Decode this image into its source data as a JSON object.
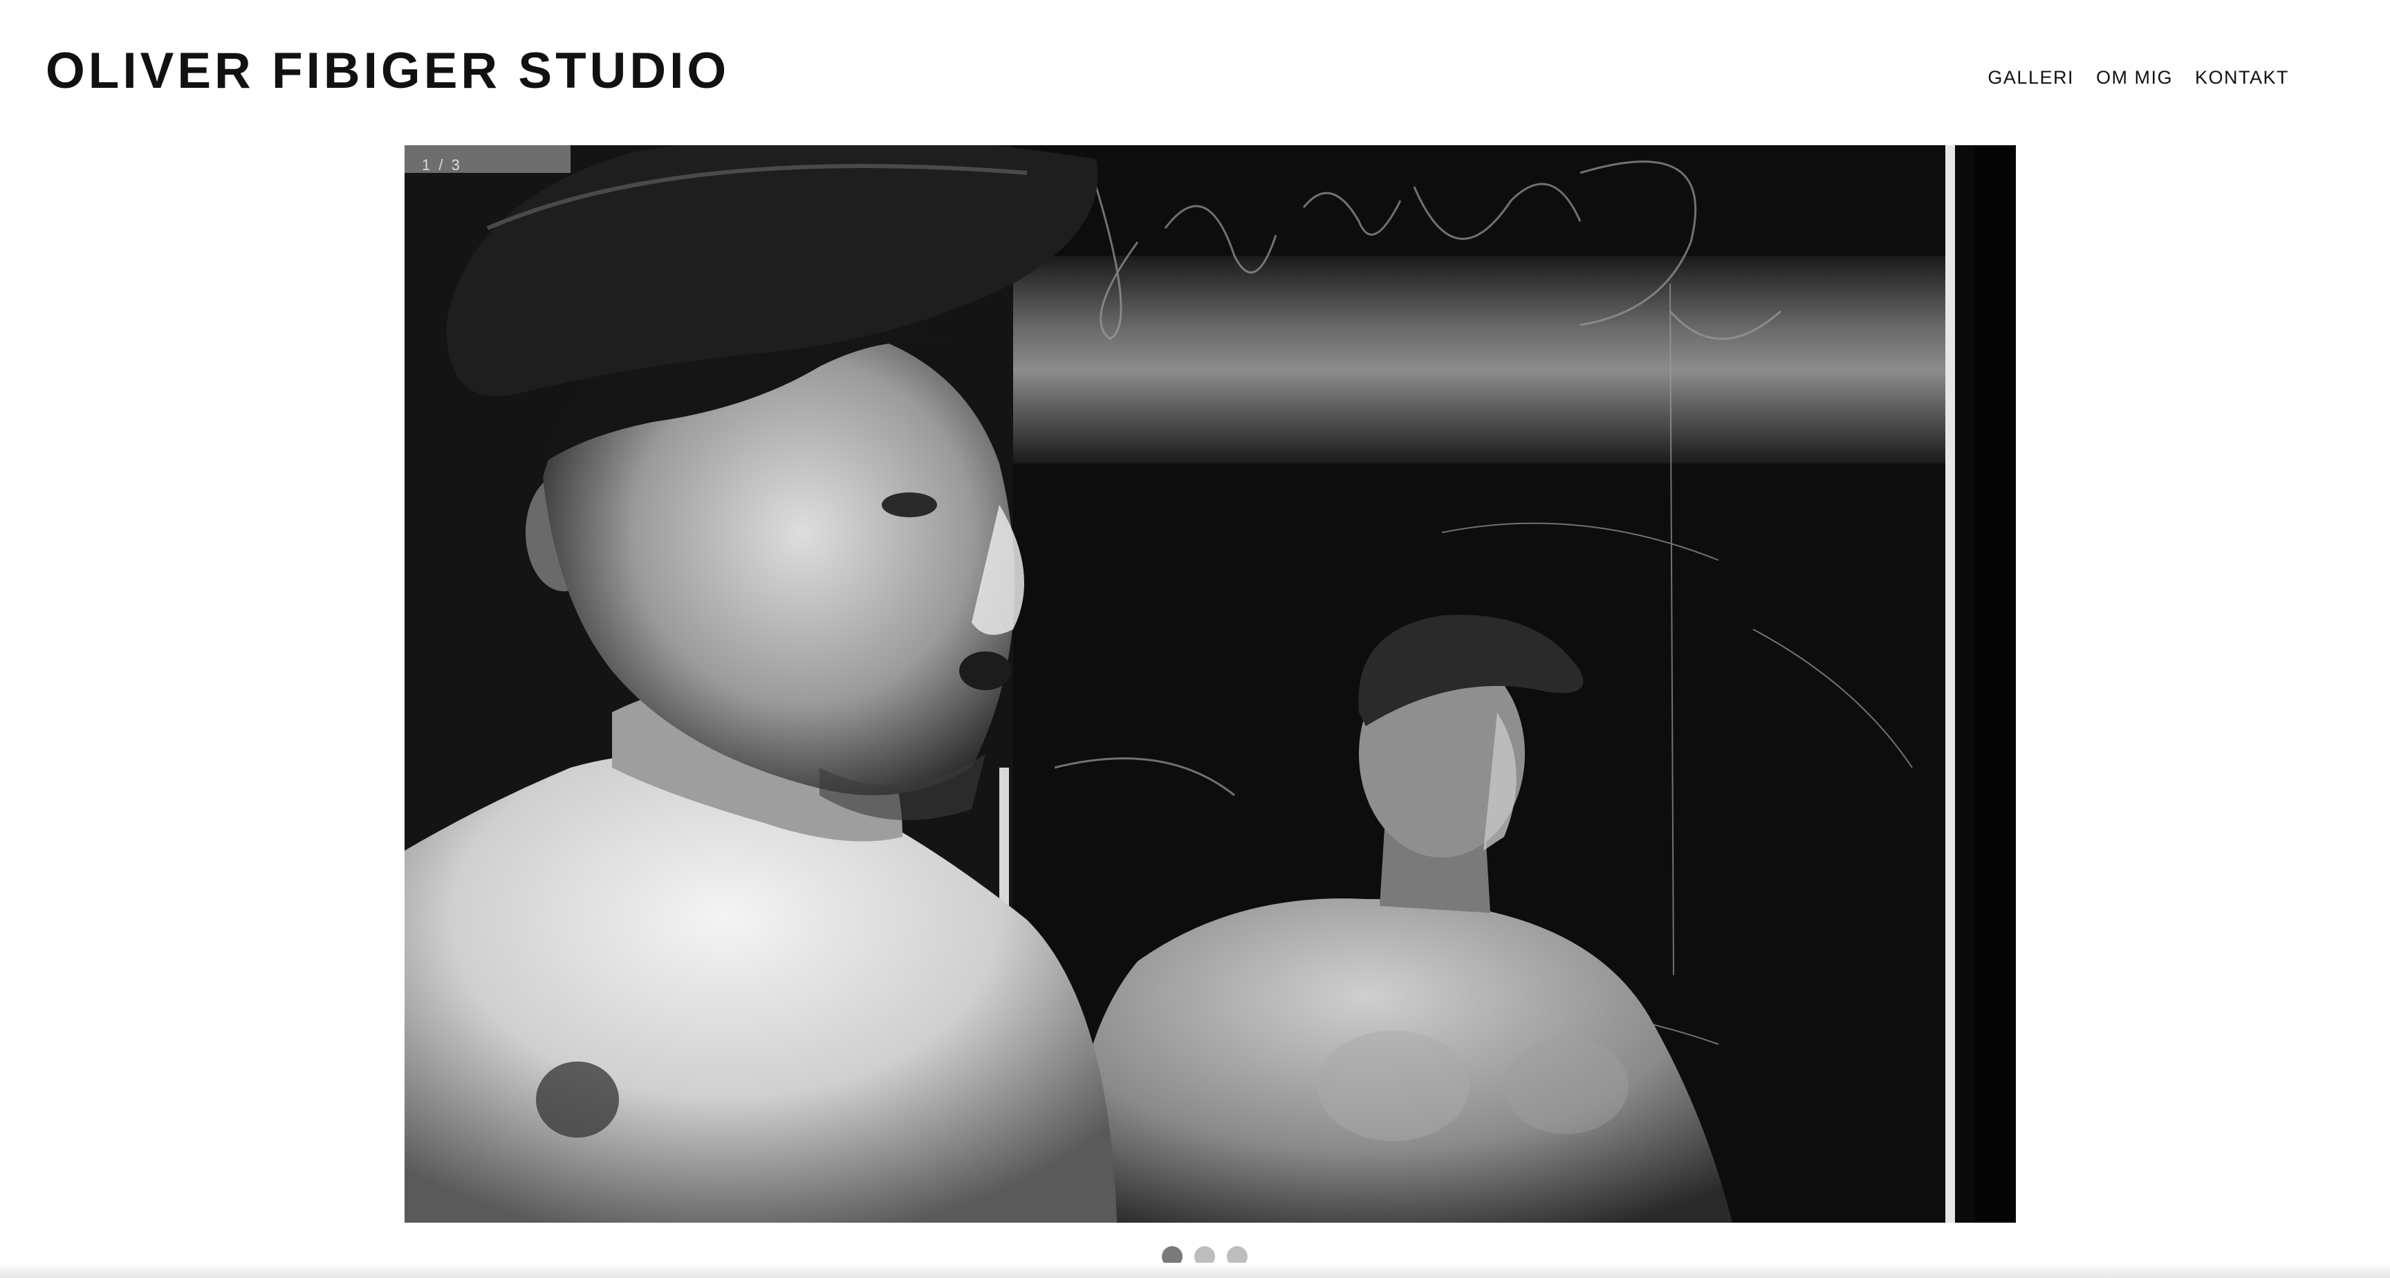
{
  "site": {
    "title": "OLIVER FIBIGER STUDIO"
  },
  "nav": {
    "items": [
      {
        "label": "GALLERI"
      },
      {
        "label": "OM MIG"
      },
      {
        "label": "KONTAKT"
      }
    ]
  },
  "slideshow": {
    "counter": "1 / 3",
    "current_slide": 1,
    "total_slides": 3,
    "image_description": "black-and-white photograph of a shirtless young man in a flat cap looking over his shoulder, with his reflection in a scratched mirror",
    "graffiti_text": "SIMONE"
  },
  "colors": {
    "background": "#ffffff",
    "text": "#111111",
    "dot_active": "#7a7a7a",
    "dot_inactive": "#bdbdbd"
  }
}
